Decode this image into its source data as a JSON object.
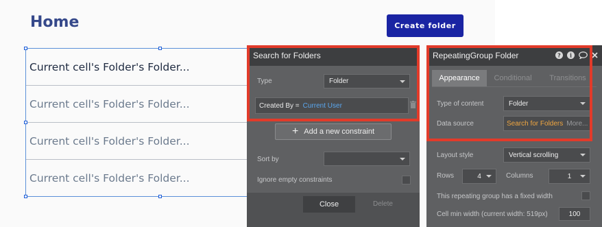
{
  "canvas": {
    "title": "Home",
    "create_button": "Create folder",
    "cells": [
      "Current cell's Folder's Folder...",
      "Current cell's Folder's Folder...",
      "Current cell's Folder's Folder...",
      "Current cell's Folder's Folder..."
    ]
  },
  "search_panel": {
    "title": "Search for Folders",
    "type_label": "Type",
    "type_value": "Folder",
    "constraint_field": "Created By =",
    "constraint_value": "Current User",
    "add_constraint": "Add a new constraint",
    "sort_label": "Sort by",
    "sort_value": "",
    "ignore_label": "Ignore empty constraints",
    "close_label": "Close",
    "delete_label": "Delete"
  },
  "property_editor": {
    "title": "RepeatingGroup Folder",
    "tabs": [
      "Appearance",
      "Conditional",
      "Transitions"
    ],
    "active_tab": "Appearance",
    "type_of_content_label": "Type of content",
    "type_of_content_value": "Folder",
    "data_source_label": "Data source",
    "data_source_value": "Search for Folders",
    "data_source_more": "More...",
    "layout_style_label": "Layout style",
    "layout_style_value": "Vertical scrolling",
    "rows_label": "Rows",
    "rows_value": "4",
    "columns_label": "Columns",
    "columns_value": "1",
    "fixed_width_label": "This repeating group has a fixed width",
    "cell_min_width_label": "Cell min width (current width: 519px)",
    "cell_min_width_value": "100"
  },
  "colors": {
    "highlight": "#e23b2a",
    "primary_button": "#1a24a3",
    "title_text": "#35488a",
    "dynamic_value": "#5aa7ef",
    "data_source": "#f0a640"
  }
}
